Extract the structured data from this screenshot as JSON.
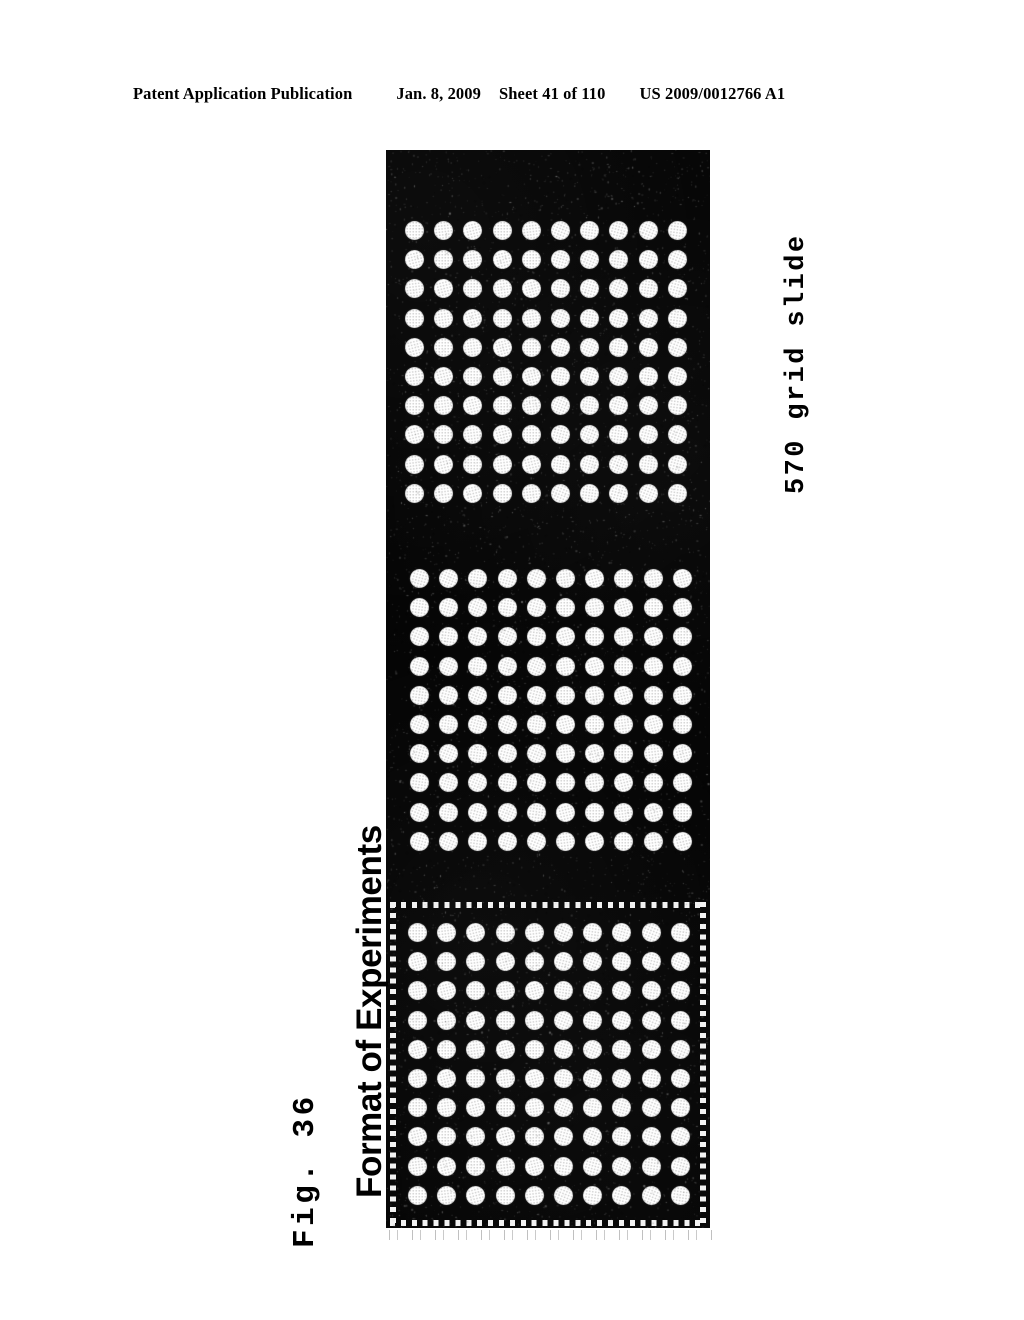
{
  "header": {
    "publication": "Patent Application Publication",
    "date": "Jan. 8, 2009",
    "sheet": "Sheet 41 of 110",
    "doc_number": "US 2009/0012766 A1"
  },
  "figure": {
    "figure_label": "Fig. 36",
    "title": "Format of Experiments",
    "slide_label": "570 grid slide",
    "panel_background": "#040404",
    "spot_color": "#d8d8d8",
    "blocks": [
      {
        "name": "block-top",
        "rows": 10,
        "columns": 10,
        "spot_count": 100,
        "has_registration_border": false
      },
      {
        "name": "block-middle",
        "rows": 10,
        "columns": 10,
        "spot_count": 100,
        "has_registration_border": false
      },
      {
        "name": "block-bottom",
        "rows": 10,
        "columns": 10,
        "spot_count": 100,
        "has_registration_border": true
      }
    ]
  }
}
